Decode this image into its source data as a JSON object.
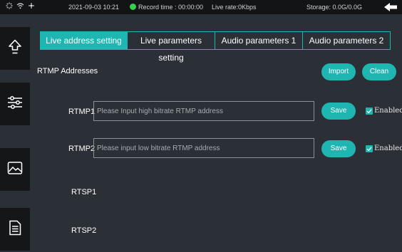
{
  "statusbar": {
    "date": "2021-09-03 10:21",
    "record_time": "Record time : 00:00:00",
    "live_rate": "Live rate:0Kbps",
    "storage": "Storage: 0.0G/0.0G"
  },
  "sidebar": {
    "items": [
      {
        "icon": "upload-arrow-icon"
      },
      {
        "icon": "sliders-icon"
      },
      {
        "icon": "image-icon"
      },
      {
        "icon": "document-icon"
      }
    ]
  },
  "tabs": [
    {
      "label": "Live address setting",
      "active": true
    },
    {
      "label": "Live parameters setting",
      "active": false
    },
    {
      "label": "Audio parameters 1",
      "active": false
    },
    {
      "label": "Audio parameters 2",
      "active": false
    }
  ],
  "section": {
    "title": "RTMP Addresses",
    "import_label": "Import",
    "clean_label": "Clean"
  },
  "rows": [
    {
      "label": "RTMP1",
      "placeholder": "Please Input high bitrate RTMP address",
      "value": "",
      "save_label": "Save",
      "enabled_label": "Enabled",
      "enabled": true
    },
    {
      "label": "RTMP2",
      "placeholder": "Please input low bitrate RTMP address",
      "value": "",
      "save_label": "Save",
      "enabled_label": "Enabled",
      "enabled": true
    }
  ],
  "rtsp": {
    "rtsp1_label": "RTSP1",
    "rtsp2_label": "RTSP2"
  },
  "colors": {
    "accent": "#1fb6b2",
    "background": "#2b3037",
    "statusbar": "#121416",
    "record_indicator": "#33d14c"
  }
}
